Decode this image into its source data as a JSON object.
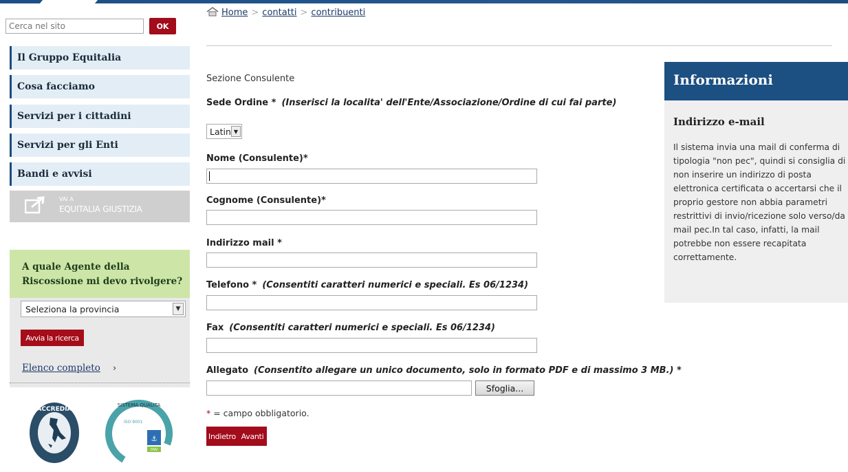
{
  "search": {
    "placeholder": "Cerca nel sito",
    "button_label": "OK"
  },
  "nav": {
    "items": [
      {
        "label": "Il Gruppo Equitalia"
      },
      {
        "label": "Cosa facciamo"
      },
      {
        "label": "Servizi per i cittadini"
      },
      {
        "label": "Servizi per gli Enti"
      },
      {
        "label": "Bandi e avvisi"
      }
    ]
  },
  "giustizia": {
    "small": "VAI A",
    "label": "EQUITALIA GIUSTIZIA"
  },
  "agent_panel": {
    "title": "A quale Agente della Riscossione mi devo rivolgere?",
    "select_value": "Seleziona la provincia",
    "search_button": "Avvia la ricerca",
    "full_list_link": "Elenco completo",
    "chevron": "›"
  },
  "logos": {
    "accredia": "ACCREDIA",
    "certification": "CERTIFICAZIONE DI SISTEMA QUALITA · ISO 9001 · DNV"
  },
  "breadcrumb": {
    "home": "Home",
    "items": [
      "contatti",
      "contribuenti"
    ],
    "separator": ">"
  },
  "form": {
    "section": "Sezione Consulente",
    "sede_label": "Sede Ordine *",
    "sede_hint": "(Inserisci la localita' dell'Ente/Associazione/Ordine di cui fai parte)",
    "sede_value": "Latina",
    "nome_label": "Nome (Consulente)*",
    "cognome_label": "Cognome (Consulente)*",
    "mail_label": "Indirizzo mail *",
    "telefono_label": "Telefono *",
    "telefono_hint": "(Consentiti caratteri numerici e speciali. Es 06/1234)",
    "fax_label": "Fax",
    "fax_hint": "(Consentiti caratteri numerici e speciali. Es 06/1234)",
    "allegato_label": "Allegato",
    "allegato_hint": "(Consentito allegare un unico documento, solo in formato PDF e di massimo 3 MB.) *",
    "browse_button": "Sfoglia...",
    "required_star": "*",
    "required_note": "= campo obbligatorio.",
    "back_button": "Indietro",
    "next_button": "Avanti"
  },
  "info": {
    "title": "Informazioni",
    "subtitle": "Indirizzo e-mail",
    "text": "Il sistema invia una mail di conferma di tipologia \"non pec\", quindi si consiglia di non inserire un indirizzo di posta elettronica certificata o accertarsi che il proprio gestore non abbia parametri restrittivi di invio/ricezione solo verso/da mail pec.In tal caso, infatti, la mail potrebbe non essere recapitata correttamente."
  },
  "colors": {
    "brand_blue": "#1c4f82",
    "brand_red": "#a20c1b",
    "nav_bg": "#e3edf6",
    "agent_green": "#cde6a8"
  }
}
